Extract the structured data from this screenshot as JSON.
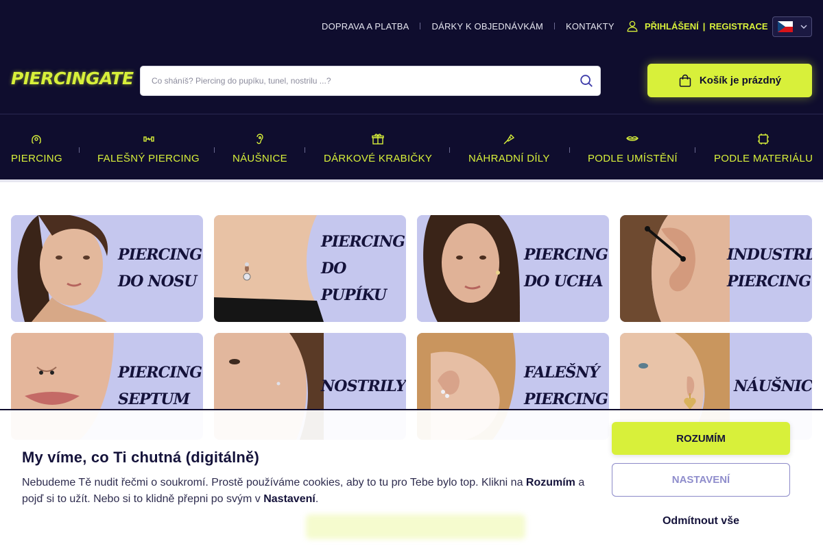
{
  "header": {
    "top_links": [
      "DOPRAVA A PLATBA",
      "DÁRKY K OBJEDNÁVKÁM",
      "KONTAKTY"
    ],
    "login": "PŘIHLÁŠENÍ",
    "separator": "|",
    "register": "REGISTRACE",
    "language": "cs",
    "logo": "PIERCINGATE",
    "search_placeholder": "Co sháníš? Piercing do pupíku, tunel, nostrilu ...?",
    "cart_label": "Košík je prázdný",
    "accent_color": "#d8f03a",
    "bg_color": "#0f0d2e"
  },
  "nav": [
    {
      "label": "PIERCING",
      "icon": "piercing-ring-icon"
    },
    {
      "label": "FALEŠNÝ PIERCING",
      "icon": "fake-piercing-icon"
    },
    {
      "label": "NÁUŠNICE",
      "icon": "ear-icon"
    },
    {
      "label": "DÁRKOVÉ KRABIČKY",
      "icon": "gift-icon"
    },
    {
      "label": "NÁHRADNÍ DÍLY",
      "icon": "spare-parts-icon"
    },
    {
      "label": "PODLE UMÍSTĚNÍ",
      "icon": "lips-icon"
    },
    {
      "label": "PODLE MATERIÁLU",
      "icon": "material-icon"
    }
  ],
  "categories": [
    {
      "label": "PIERCING\nDO NOSU"
    },
    {
      "label": "PIERCING\nDO PUPÍKU"
    },
    {
      "label": "PIERCING\nDO UCHA"
    },
    {
      "label": "INDUSTRIAL\nPIERCING"
    },
    {
      "label": "PIERCING\nSEPTUM"
    },
    {
      "label": "NOSTRILY"
    },
    {
      "label": "FALEŠNÝ\nPIERCING"
    },
    {
      "label": "NÁUŠNICE"
    }
  ],
  "cookie": {
    "title": "My víme, co Ti chutná (digitálně)",
    "text_1": "Nebudeme Tě nudit řečmi o soukromí. Prostě používáme cookies, aby to tu pro Tebe bylo top. Klikni na ",
    "text_bold_1": "Rozumím",
    "text_2": " a pojď si to užít. Nebo si to klidně přepni po svým v ",
    "text_bold_2": "Nastavení",
    "text_3": ".",
    "accept": "ROZUMÍM",
    "settings": "NASTAVENÍ",
    "reject": "Odmítnout vše"
  }
}
